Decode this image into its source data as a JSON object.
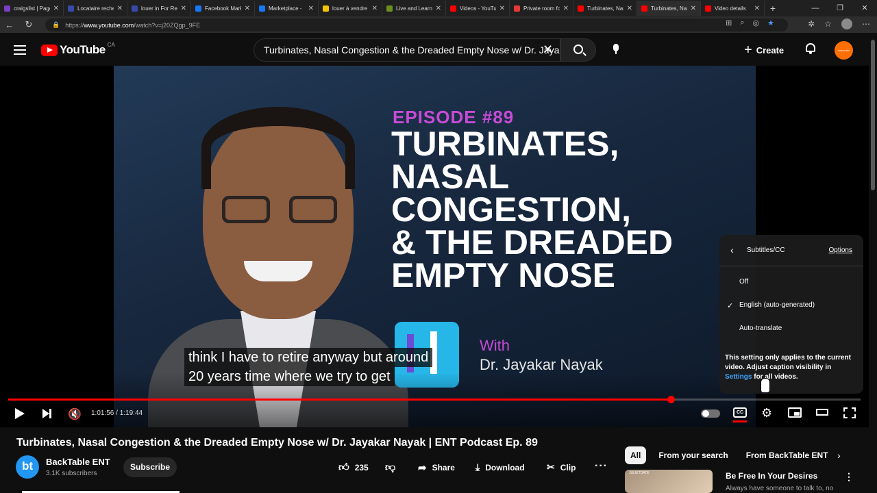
{
  "browser": {
    "tabs": [
      {
        "label": "craigslist | Page",
        "color": "#7b3fc4"
      },
      {
        "label": "Locataire recherche",
        "color": "#3949ab"
      },
      {
        "label": "louer in For Rent",
        "color": "#3949ab"
      },
      {
        "label": "Facebook Marketplace",
        "color": "#1877f2"
      },
      {
        "label": "Marketplace -",
        "color": "#1877f2"
      },
      {
        "label": "louer à vendre",
        "color": "#f5c400"
      },
      {
        "label": "Live and Learn",
        "color": "#6b8e23"
      },
      {
        "label": "Videos - YouTube",
        "color": "#ff0000"
      },
      {
        "label": "Private room for",
        "color": "#e53935"
      },
      {
        "label": "Turbinates, Nasal",
        "color": "#ff0000"
      },
      {
        "label": "Turbinates, Nasal",
        "color": "#ff0000"
      },
      {
        "label": "Video details",
        "color": "#ff0000"
      }
    ],
    "active_tab_index": 10,
    "new_tab": "+",
    "url_prefix": "https://",
    "url_host": "www.youtube.com",
    "url_path": "/watch?v=j20ZQgp_9FE"
  },
  "youtube": {
    "logo_text": "YouTube",
    "country_code": "CA",
    "search_value": "Turbinates, Nasal Congestion & the Dreaded Empty Nose w/ Dr. Jayakar",
    "create_label": "Create",
    "avatar_text": "subscribe"
  },
  "video_frame": {
    "episode": "EPISODE #89",
    "title_lines": [
      "TURBINATES,",
      "NASAL",
      "CONGESTION,",
      "& THE DREADED",
      "EMPTY NOSE"
    ],
    "with": "With",
    "guest": "Dr. Jayakar Nayak"
  },
  "caption": {
    "line1": "think I have to retire anyway but around",
    "line2": "20 years time where we try to get"
  },
  "subtitles_menu": {
    "title": "Subtitles/CC",
    "options_link": "Options",
    "items": [
      "Off",
      "English (auto-generated)",
      "Auto-translate"
    ],
    "selected_index": 1,
    "note_text": "This setting only applies to the current video. Adjust caption visibility in",
    "note_link": "Settings",
    "note_tail": "for all videos."
  },
  "player": {
    "time_current": "1:01:56",
    "time_total": "1:19:44",
    "time_display": "1:01:56 / 1:19:44",
    "progress_fraction": 0.777,
    "accent": "#ff0000"
  },
  "video_info": {
    "title": "Turbinates, Nasal Congestion & the Dreaded Empty Nose w/ Dr. Jayakar Nayak | ENT Podcast Ep. 89",
    "channel_name": "BackTable ENT",
    "channel_initials": "bt",
    "subscribers": "3.1K subscribers",
    "subscribe_label": "Subscribe",
    "likes": "235",
    "share_label": "Share",
    "download_label": "Download",
    "clip_label": "Clip"
  },
  "sidebar": {
    "chips": [
      "All",
      "From your search",
      "From BackTable ENT"
    ],
    "recommendation": {
      "title": "Be Free In Your Desires",
      "subtitle": "Always have someone to talk to, no",
      "thumb_tag": "JULIETDATE"
    }
  }
}
